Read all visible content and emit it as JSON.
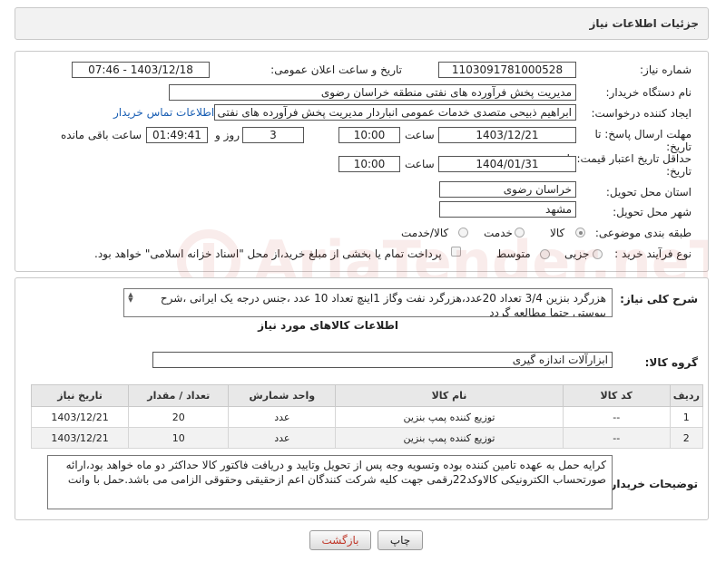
{
  "header": {
    "title": "جزئیات اطلاعات نیاز"
  },
  "fields": {
    "need_number_label": "شماره نیاز:",
    "need_number": "1103091781000528",
    "announce_label": "تاریخ و ساعت اعلان عمومی:",
    "announce_value": "1403/12/18 - 07:46",
    "buyer_org_label": "نام دستگاه خریدار:",
    "buyer_org": "مدیریت پخش فرآورده های نفتی منطقه خراسان رضوی",
    "requester_label": "ایجاد کننده درخواست:",
    "requester": "ابراهیم ذبیحی متصدی خدمات عمومی انباردار مدیریت پخش فرآورده های نفتی منطقه خراسان رضوی",
    "contact_link": "اطلاعات تماس خریدار",
    "deadline_label": "مهلت ارسال پاسخ: تا",
    "deadline_label2": "تاریخ:",
    "deadline_date": "1403/12/21",
    "time_label": "ساعت",
    "deadline_time": "10:00",
    "days_count": "3",
    "days_label": "روز و",
    "remaining_time": "01:49:41",
    "remaining_label": "ساعت باقی مانده",
    "validity_label": "حداقل تاریخ اعتبار قیمت: تا",
    "validity_label2": "تاریخ:",
    "validity_date": "1404/01/31",
    "validity_time": "10:00",
    "province_label": "استان محل تحویل:",
    "province": "خراسان رضوی",
    "city_label": "شهر محل تحویل:",
    "city": "مشهد",
    "category_label": "طبقه بندی موضوعی:",
    "category_options": [
      "کالا",
      "خدمت",
      "کالا/خدمت"
    ],
    "process_label": "نوع فرآیند خرید :",
    "process_options": [
      "جزیی",
      "متوسط"
    ],
    "payment_note": "پرداخت تمام یا بخشی از مبلغ خرید،از محل \"اسناد خزانه اسلامی\" خواهد بود."
  },
  "description": {
    "label": "شرح کلی نیاز:",
    "text": "هزرگرد بنزین 3/4 تعداد 20عدد،هزرگرد نفت وگاز 1اینچ تعداد 10 عدد ،جنس درجه یک ایرانی ،شرح پیوستی حتما مطالعه گردد"
  },
  "goods": {
    "section_title": "اطلاعات کالاهای مورد نیاز",
    "group_label": "گروه کالا:",
    "group_value": "ابزارآلات اندازه گیری",
    "columns": [
      "ردیف",
      "کد کالا",
      "نام کالا",
      "واحد شمارش",
      "تعداد / مقدار",
      "تاریخ نیاز"
    ],
    "rows": [
      [
        "1",
        "--",
        "توزیع کننده پمپ بنزین",
        "عدد",
        "20",
        "1403/12/21"
      ],
      [
        "2",
        "--",
        "توزیع کننده پمپ بنزین",
        "عدد",
        "10",
        "1403/12/21"
      ]
    ]
  },
  "buyer_notes": {
    "label": "توضیحات خریدار:",
    "text": "کرایه حمل به عهده تامین کننده بوده وتسویه وجه پس از تحویل وتایید و دریافت فاکتور کالا حداکثر دو ماه خواهد بود،ارائه صورتحساب الکترونیکی کالاوکد22رقمی جهت کلیه شرکت کنندگان اعم ازحقیقی وحقوقی الزامی می باشد.حمل با وانت"
  },
  "buttons": {
    "print": "چاپ",
    "back": "بازگشت"
  },
  "watermark_text": "AriaTender.neT"
}
